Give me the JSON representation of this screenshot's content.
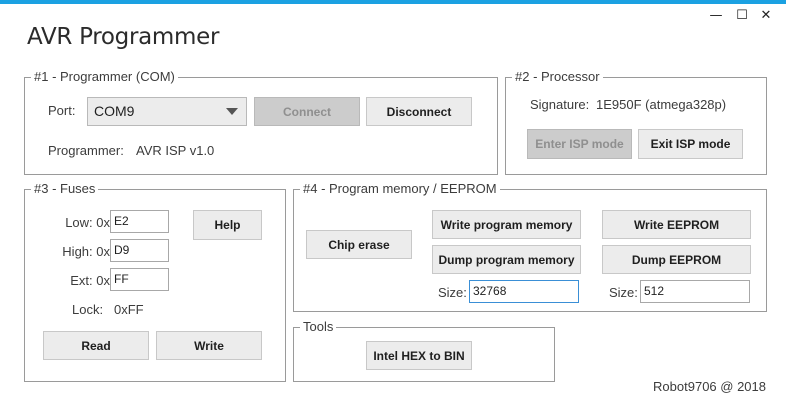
{
  "window": {
    "title": "AVR Programmer",
    "minimize_glyph": "—",
    "maximize_glyph": "☐",
    "close_glyph": "✕",
    "accent_color": "#1ba1e2"
  },
  "programmer": {
    "legend": "#1 - Programmer (COM)",
    "port_label": "Port:",
    "port_value": "COM9",
    "connect_label": "Connect",
    "disconnect_label": "Disconnect",
    "programmer_label": "Programmer:",
    "programmer_value": "AVR ISP v1.0"
  },
  "processor": {
    "legend": "#2 - Processor",
    "signature_label": "Signature:",
    "signature_value": "1E950F (atmega328p)",
    "enter_isp_label": "Enter ISP mode",
    "exit_isp_label": "Exit ISP mode"
  },
  "fuses": {
    "legend": "#3 - Fuses",
    "low_label": "Low: 0x",
    "low_value": "E2",
    "high_label": "High: 0x",
    "high_value": "D9",
    "ext_label": "Ext: 0x",
    "ext_value": "FF",
    "lock_label": "Lock:",
    "lock_value": "0xFF",
    "help_label": "Help",
    "read_label": "Read",
    "write_label": "Write"
  },
  "memory": {
    "legend": "#4 - Program memory / EEPROM",
    "chip_erase_label": "Chip erase",
    "write_program_label": "Write program memory",
    "dump_program_label": "Dump program memory",
    "program_size_label": "Size:",
    "program_size_value": "32768",
    "write_eeprom_label": "Write EEPROM",
    "dump_eeprom_label": "Dump EEPROM",
    "eeprom_size_label": "Size:",
    "eeprom_size_value": "512"
  },
  "tools": {
    "legend": "Tools",
    "hex_to_bin_label": "Intel HEX to BIN"
  },
  "footer": {
    "text": "Robot9706 @ 2018"
  }
}
